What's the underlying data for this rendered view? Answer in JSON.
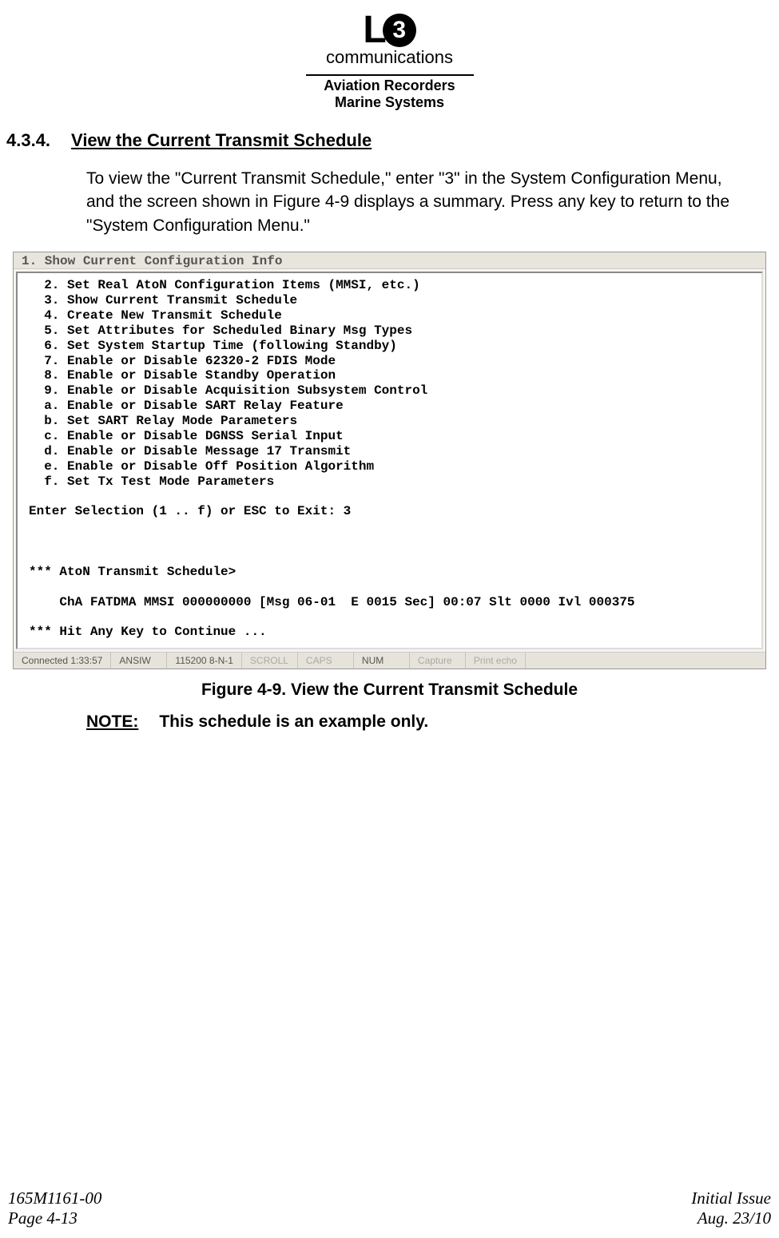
{
  "header": {
    "logo_letter": "L",
    "logo_digit": "3",
    "logo_text": "communications",
    "line1": "Aviation Recorders",
    "line2": "Marine Systems"
  },
  "section": {
    "number": "4.3.4.",
    "title": "View the Current Transmit Schedule"
  },
  "paragraph": "To view the \"Current Transmit Schedule,\" enter \"3\" in the System Configuration Menu, and the screen shown in Figure 4-9 displays a summary. Press any key to return to the \"System Configuration Menu.\"",
  "terminal": {
    "cut_line": "1. Show Current Configuration Info",
    "menu": [
      "  2. Set Real AtoN Configuration Items (MMSI, etc.)",
      "  3. Show Current Transmit Schedule",
      "  4. Create New Transmit Schedule",
      "  5. Set Attributes for Scheduled Binary Msg Types",
      "  6. Set System Startup Time (following Standby)",
      "  7. Enable or Disable 62320-2 FDIS Mode",
      "  8. Enable or Disable Standby Operation",
      "  9. Enable or Disable Acquisition Subsystem Control",
      "  a. Enable or Disable SART Relay Feature",
      "  b. Set SART Relay Mode Parameters",
      "  c. Enable or Disable DGNSS Serial Input",
      "  d. Enable or Disable Message 17 Transmit",
      "  e. Enable or Disable Off Position Algorithm",
      "  f. Set Tx Test Mode Parameters",
      "",
      "Enter Selection (1 .. f) or ESC to Exit: 3",
      "",
      "",
      "",
      "*** AtoN Transmit Schedule>",
      "",
      "    ChA FATDMA MMSI 000000000 [Msg 06-01  E 0015 Sec] 00:07 Slt 0000 Ivl 000375",
      "",
      "*** Hit Any Key to Continue ..."
    ],
    "status": {
      "connected": "Connected 1:33:57",
      "emu": "ANSIW",
      "port": "115200 8-N-1",
      "scroll": "SCROLL",
      "caps": "CAPS",
      "num": "NUM",
      "capture": "Capture",
      "print": "Print echo"
    }
  },
  "figure_caption": "Figure 4-9.  View the Current Transmit Schedule",
  "note": {
    "label": "NOTE:",
    "text": "This schedule is an example only."
  },
  "footer": {
    "doc_no": "165M1161-00",
    "page": "Page 4-13",
    "issue": "Initial Issue",
    "date": "Aug. 23/10"
  }
}
